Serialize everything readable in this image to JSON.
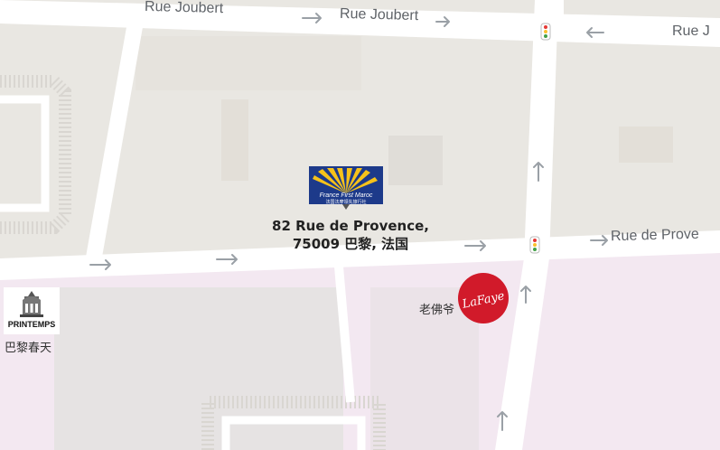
{
  "streets": {
    "rue_joubert_1": "Rue Joubert",
    "rue_joubert_2": "Rue Joubert",
    "rue_joubert_3": "Rue J",
    "rue_de_provence": "Rue de Prove"
  },
  "marker": {
    "brand_text": "France First Maroc",
    "brand_subtext": "法国法摩领先旅行社",
    "address_line1": "82 Rue de Provence,",
    "address_line2": "75009 巴黎, 法国"
  },
  "pois": {
    "printemps_logo_text": "PRINTEMPS",
    "printemps_label": "巴黎春天",
    "lafayette_logo_text": "LaFaye",
    "lafayette_label": "老佛爷"
  },
  "colors": {
    "land": "#e9e7e2",
    "road": "#ffffff",
    "district_pink": "#f3e8f1",
    "building": "#e3dfd8",
    "pedestrian_dots": "#e0ddd8",
    "arrow": "#9aa0a6",
    "marker_blue": "#1d3a8a",
    "marker_sun": "#f6c21a",
    "lafayette_red": "#d11a2a"
  }
}
